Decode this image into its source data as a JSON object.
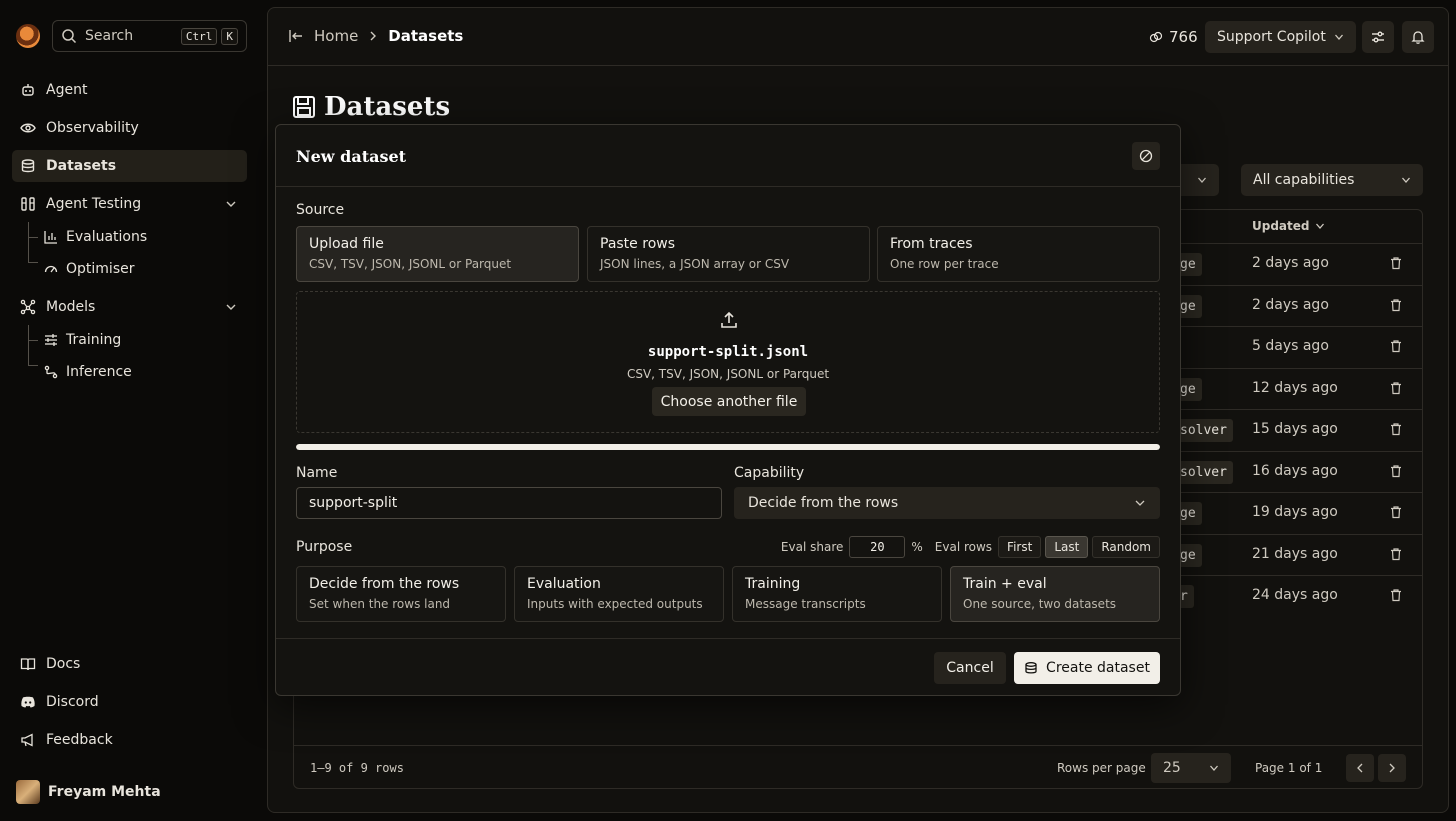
{
  "sidebar": {
    "search": {
      "placeholder": "Search",
      "kbd1": "Ctrl",
      "kbd2": "K"
    },
    "nav": {
      "agent": "Agent",
      "observability": "Observability",
      "datasets": "Datasets",
      "agent_testing": "Agent Testing",
      "evaluations": "Evaluations",
      "optimiser": "Optimiser",
      "models": "Models",
      "training": "Training",
      "inference": "Inference",
      "docs": "Docs",
      "discord": "Discord",
      "feedback": "Feedback"
    },
    "user": {
      "name": "Freyam Mehta"
    }
  },
  "header": {
    "breadcrumb": {
      "home": "Home",
      "current": "Datasets"
    },
    "credits": "766",
    "project": "Support Copilot"
  },
  "page": {
    "title": "Datasets",
    "filter_capabilities": "All capabilities",
    "table": {
      "updated_header": "Updated",
      "rows": [
        {
          "tag": "ge",
          "updated": "2 days ago"
        },
        {
          "tag": "ge",
          "updated": "2 days ago"
        },
        {
          "tag": "",
          "updated": "5 days ago"
        },
        {
          "tag": "ge",
          "updated": "12 days ago"
        },
        {
          "tag": "solver",
          "updated": "15 days ago"
        },
        {
          "tag": "solver",
          "updated": "16 days ago"
        },
        {
          "tag": "ge",
          "updated": "19 days ago"
        },
        {
          "tag": "ge",
          "updated": "21 days ago"
        },
        {
          "tag": "r",
          "updated": "24 days ago"
        }
      ],
      "footer": {
        "count": "1–9 of 9 rows",
        "rows_per_page_label": "Rows per page",
        "rows_per_page": "25",
        "page": "Page 1 of 1"
      }
    }
  },
  "modal": {
    "title": "New dataset",
    "source_label": "Source",
    "sources": [
      {
        "title": "Upload file",
        "desc": "CSV, TSV, JSON, JSONL or Parquet",
        "selected": true
      },
      {
        "title": "Paste rows",
        "desc": "JSON lines, a JSON array or CSV",
        "selected": false
      },
      {
        "title": "From traces",
        "desc": "One row per trace",
        "selected": false
      }
    ],
    "upload": {
      "filename": "support-split.jsonl",
      "formats": "CSV, TSV, JSON, JSONL or Parquet",
      "choose_label": "Choose another file",
      "progress": 1.0
    },
    "name_label": "Name",
    "name_value": "support-split",
    "capability_label": "Capability",
    "capability_value": "Decide from the rows",
    "purpose_label": "Purpose",
    "eval_share_label": "Eval share",
    "eval_share_value": "20",
    "eval_share_unit": "%",
    "eval_rows_label": "Eval rows",
    "eval_rows_options": [
      "First",
      "Last",
      "Random"
    ],
    "eval_rows_selected": "Last",
    "purposes": [
      {
        "title": "Decide from the rows",
        "desc": "Set when the rows land",
        "selected": false
      },
      {
        "title": "Evaluation",
        "desc": "Inputs with expected outputs",
        "selected": false
      },
      {
        "title": "Training",
        "desc": "Message transcripts",
        "selected": false
      },
      {
        "title": "Train + eval",
        "desc": "One source, two datasets",
        "selected": true
      }
    ],
    "cancel_label": "Cancel",
    "create_label": "Create dataset"
  }
}
